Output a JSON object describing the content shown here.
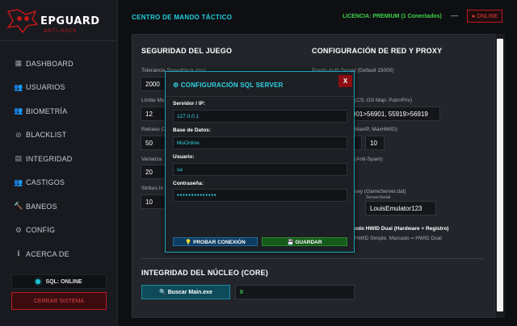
{
  "brand": {
    "name": "EPGUARD",
    "tagline": "ANTI-HACK"
  },
  "sidebar": {
    "items": [
      {
        "label": "DASHBOARD",
        "icon": "dashboard-icon",
        "glyph": "▦"
      },
      {
        "label": "USUARIOS",
        "icon": "users-icon",
        "glyph": "👥"
      },
      {
        "label": "BIOMETRÍA",
        "icon": "biometry-icon",
        "glyph": "👥"
      },
      {
        "label": "BLACKLIST",
        "icon": "ban-icon",
        "glyph": "⊘"
      },
      {
        "label": "INTEGRIDAD",
        "icon": "database-icon",
        "glyph": "▤"
      },
      {
        "label": "CASTIGOS",
        "icon": "punishment-icon",
        "glyph": "👥"
      },
      {
        "label": "BANEOS",
        "icon": "hammer-icon",
        "glyph": "🔨"
      },
      {
        "label": "CONFIG",
        "icon": "gear-icon",
        "glyph": "⚙"
      },
      {
        "label": "ACERCA DE",
        "icon": "info-icon",
        "glyph": "ℹ"
      }
    ],
    "sql_status": "SQL: ONLINE",
    "logout_label": "CERRAR SISTEMA"
  },
  "header": {
    "title": "CENTRO DE MANDO TÁCTICO",
    "license": "LICENCIA: PREMIUM (1 Conectados)",
    "minimize": "—",
    "online_badge": "● ONLINE"
  },
  "security": {
    "title": "SEGURIDAD DEL JUEGO",
    "speedhack_label": "Tolerancia SpeedHack (ms)",
    "speedhack_value": "2000",
    "limit_label": "Límite Ma",
    "limit_value": "12",
    "delay_label": "Retraso C",
    "delay_value": "50",
    "variance_label": "Varianza",
    "variance_value": "20",
    "strikes_label": "Strikes In",
    "strikes_value": "10"
  },
  "network": {
    "title": "CONFIGURACIÓN DE RED Y PROXY",
    "auth_port_label": "Puerto Auth Server (Default 15000)",
    "map_label": "(CS, GS Map: Pub>Priv)",
    "map_value": "901>56901, 55919>56919",
    "maxip_label": "MaxIP, MaxHWID)",
    "maxhwid_value": "10",
    "antispam_label": "(Anti-Spam)",
    "proxy_label": "oxy (GameServer.dat)",
    "server_serial_label": "ServerSerial",
    "server_serial_value": "LouisEmulator123",
    "hwid_title": "odo HWID Dual (Hardware + Registro)",
    "hwid_desc": "HWID Simple, Marcado = HWID Dual"
  },
  "integrity": {
    "title": "INTEGRIDAD DEL NÚCLEO (CORE)",
    "search_button": "🔍 Buscar Main.exe",
    "result_value": "0"
  },
  "modal": {
    "title": "⚙ CONFIGURACIÓN SQL SERVER",
    "close": "X",
    "server_label": "Servidor / IP:",
    "server_value": "127.0.0.1",
    "db_label": "Base de Datos:",
    "db_value": "MuOnline",
    "user_label": "Usuario:",
    "user_value": "sa",
    "password_label": "Contraseña:",
    "password_value": "●●●●●●●●●●●●●●",
    "test_button": "💡 PROBAR CONEXIÓN",
    "save_button": "💾 GUARDAR"
  },
  "colors": {
    "accent_cyan": "#21d0df",
    "license_green": "#3ed24a",
    "danger_red": "#c01a22"
  }
}
